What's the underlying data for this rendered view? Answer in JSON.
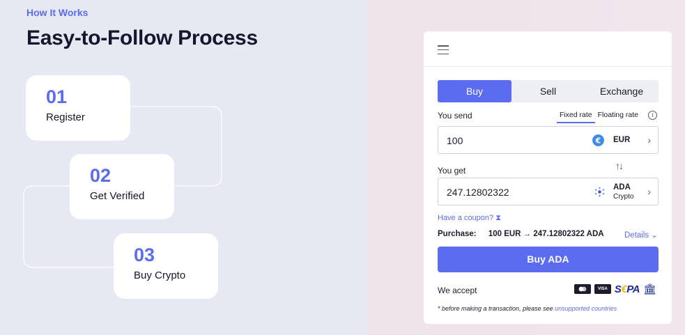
{
  "section": {
    "eyebrow": "How It Works",
    "title": "Easy-to-Follow Process"
  },
  "steps": [
    {
      "number": "01",
      "label": "Register"
    },
    {
      "number": "02",
      "label": "Get Verified"
    },
    {
      "number": "03",
      "label": "Buy Crypto"
    }
  ],
  "widget": {
    "menu_icon": "hamburger-icon",
    "tabs": [
      "Buy",
      "Sell",
      "Exchange"
    ],
    "active_tab": "Buy",
    "you_send_label": "You send",
    "rate_options": [
      "Fixed rate",
      "Floating rate"
    ],
    "active_rate": "Fixed rate",
    "send": {
      "amount": "100",
      "currency": "EUR",
      "icon": "euro-coin-icon"
    },
    "you_get_label": "You get",
    "get": {
      "amount": "247.12802322",
      "currency": "ADA",
      "network": "Crypto",
      "icon": "cardano-coin-icon"
    },
    "coupon_text": "Have a coupon?",
    "purchase_label": "Purchase:",
    "purchase_value": "100 EUR → 247.12802322 ADA",
    "details_label": "Details",
    "buy_button_label": "Buy ADA",
    "we_accept_label": "We accept",
    "payment_methods": [
      "mastercard-icon",
      "visa-icon",
      "sepa-logo",
      "bank-icon"
    ],
    "card_visa_text": "VISA",
    "footnote_prefix": "* before making a transaction, please see",
    "footnote_link": "unsupported countries"
  },
  "colors": {
    "accent": "#5b6cf0",
    "text_dark": "#14152b",
    "left_bg": "#e6e8f2",
    "right_bg": "#efe3ea"
  }
}
